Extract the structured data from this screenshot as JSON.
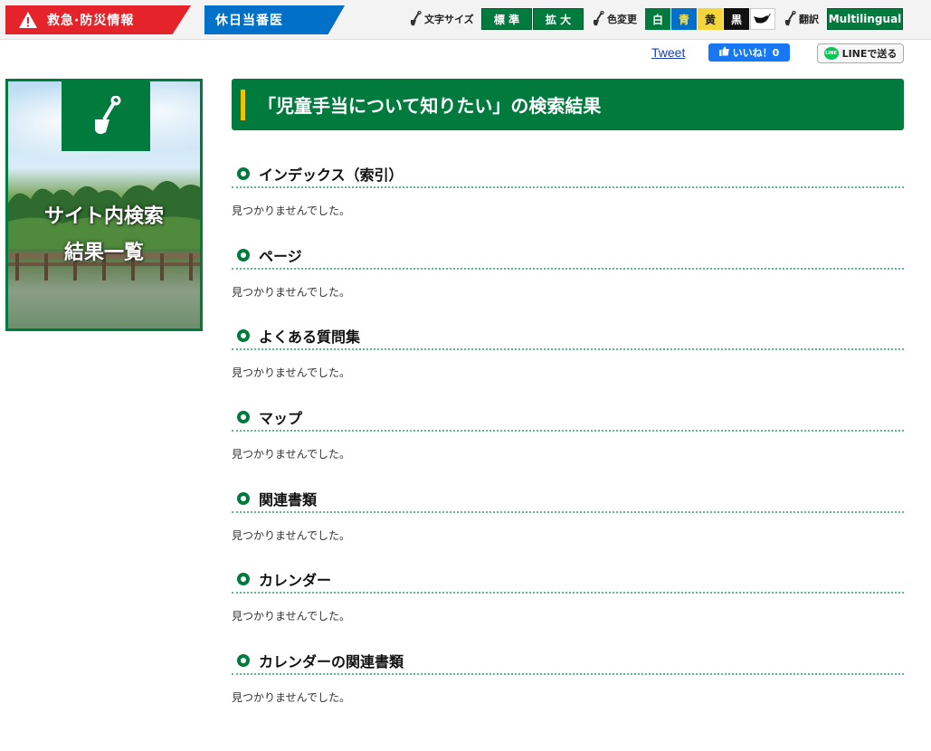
{
  "header": {
    "emergency_label": "救急·防災情報",
    "holiday_doctor_label": "休日当番医",
    "font_size": {
      "label": "文字サイズ",
      "standard": "標 準",
      "large": "拡 大"
    },
    "color_change": {
      "label": "色変更",
      "white": "白",
      "blue": "青",
      "yellow": "黄",
      "black": "黒"
    },
    "translate": {
      "label": "翻訳"
    },
    "multilingual": "Multilingual"
  },
  "share": {
    "tweet": "Tweet",
    "facebook_like": "いいね！0",
    "line": "LINEで送る",
    "line_logo": "LINE"
  },
  "sidebar": {
    "banner_line1": "サイト内検索",
    "banner_line2": "結果一覧"
  },
  "main": {
    "title": "「児童手当について知りたい」の検索結果",
    "sections": [
      {
        "heading": "インデックス（索引）",
        "result": "見つかりませんでした。"
      },
      {
        "heading": "ページ",
        "result": "見つかりませんでした。"
      },
      {
        "heading": "よくある質問集",
        "result": "見つかりませんでした。"
      },
      {
        "heading": "マップ",
        "result": "見つかりませんでした。"
      },
      {
        "heading": "関連書類",
        "result": "見つかりませんでした。"
      },
      {
        "heading": "カレンダー",
        "result": "見つかりませんでした。"
      },
      {
        "heading": "カレンダーの関連書類",
        "result": "見つかりませんでした。"
      }
    ]
  },
  "colors": {
    "brand_green": "#007a3d",
    "emergency_red": "#e4232a",
    "doctor_blue": "#0070c9",
    "title_accent": "#f2c200"
  },
  "icons": [
    "warning-icon",
    "shovel-icon",
    "bird-icon",
    "facebook-like-icon",
    "line-icon"
  ]
}
